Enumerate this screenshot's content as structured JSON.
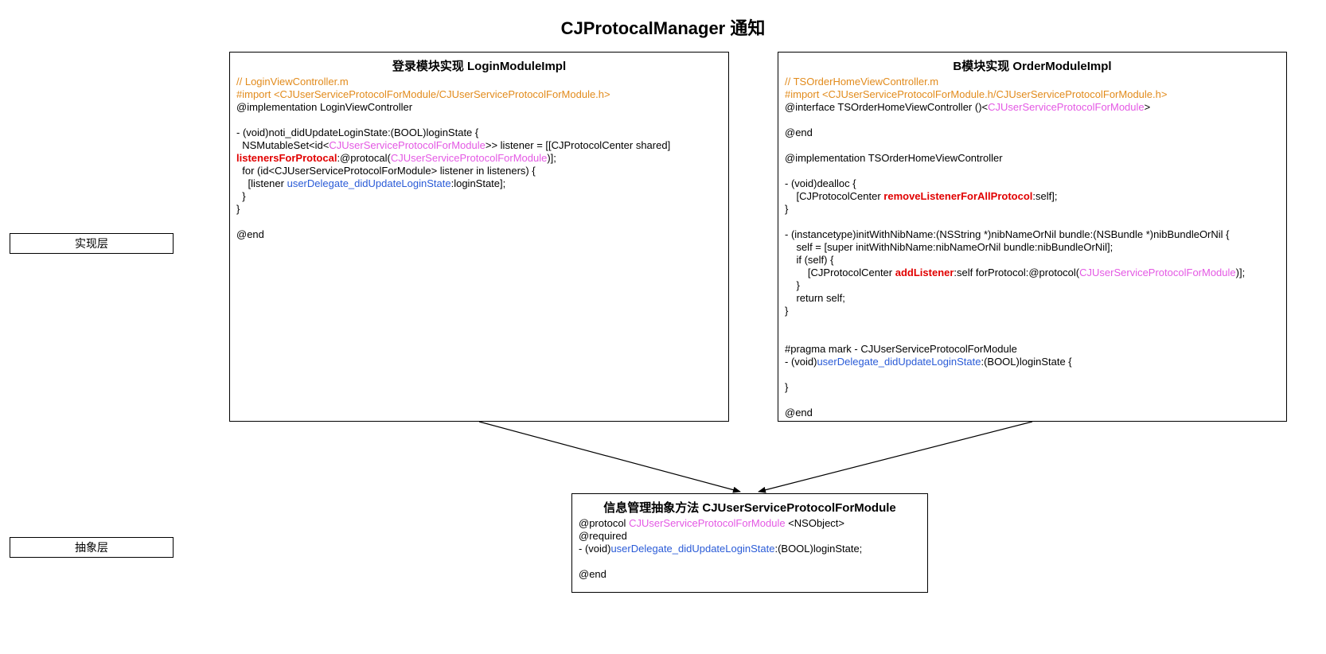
{
  "title": "CJProtocalManager 通知",
  "side": {
    "impl": "实现层",
    "abstract": "抽象层"
  },
  "boxA": {
    "title": "登录模块实现 LoginModuleImpl",
    "l1": "// LoginViewController.m",
    "l2": "#import <CJUserServiceProtocolForModule/CJUserServiceProtocolForModule.h>",
    "l3": "@implementation LoginViewController",
    "l4": "- (void)noti_didUpdateLoginState:(BOOL)loginState {",
    "l5a": "  NSMutableSet<id<",
    "l5b": "CJUserServiceProtocolForModule",
    "l5c": ">> listener = [[CJProtocolCenter shared] ",
    "l6a": "listenersForProtocal",
    "l6b": ":@protocal(",
    "l6c": "CJUserServiceProtocolForModule",
    "l6d": ")];",
    "l7": "  for (id<CJUserServiceProtocolForModule> listener in listeners) {",
    "l8a": "    [listener ",
    "l8b": "userDelegate_didUpdateLoginState",
    "l8c": ":loginState];",
    "l9": "  }",
    "l10": "}",
    "l11": "@end"
  },
  "boxB": {
    "title": "B模块实现 OrderModuleImpl",
    "l1": "// TSOrderHomeViewController.m",
    "l2": "#import <CJUserServiceProtocolForModule.h/CJUserServiceProtocolForModule.h>",
    "l3a": "@interface TSOrderHomeViewController ()<",
    "l3b": "CJUserServiceProtocolForModule",
    "l3c": ">",
    "l4": "@end",
    "l5": "@implementation TSOrderHomeViewController",
    "l6": "- (void)dealloc {",
    "l7a": "    [CJProtocolCenter ",
    "l7b": "removeListenerForAllProtocol",
    "l7c": ":self];",
    "l8": "}",
    "l9": "- (instancetype)initWithNibName:(NSString *)nibNameOrNil bundle:(NSBundle *)nibBundleOrNil {",
    "l10": "    self = [super initWithNibName:nibNameOrNil bundle:nibBundleOrNil];",
    "l11": "    if (self) {",
    "l12a": "        [CJProtocolCenter ",
    "l12b": "addListener",
    "l12c": ":self forProtocol:@protocol(",
    "l12d": "CJUserServiceProtocolForModule",
    "l12e": ")];",
    "l13": "    }",
    "l14": "    return self;",
    "l15": "}",
    "l16": "#pragma mark - CJUserServiceProtocolForModule",
    "l17a": "- (void)",
    "l17b": "userDelegate_didUpdateLoginState",
    "l17c": ":(BOOL)loginState {",
    "l18": "}",
    "l19": "@end"
  },
  "boxC": {
    "title": "信息管理抽象方法 CJUserServiceProtocolForModule",
    "l1a": "@protocol ",
    "l1b": "CJUserServiceProtocolForModule",
    "l1c": " <NSObject>",
    "l2": "@required",
    "l3a": "- (void)",
    "l3b": "userDelegate_didUpdateLoginState",
    "l3c": ":(BOOL)loginState;",
    "l4": "@end"
  }
}
